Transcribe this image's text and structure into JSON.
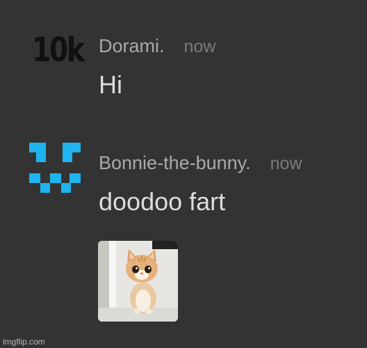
{
  "messages": [
    {
      "avatar_text": "10k",
      "author": "Dorami.",
      "time": "now",
      "content": "Hi"
    },
    {
      "avatar_icon": "pixel-face-icon",
      "author": "Bonnie-the-bunny.",
      "time": "now",
      "content": "doodoo fart",
      "attachment_icon": "kitten-photo"
    }
  ],
  "colors": {
    "background": "#333333",
    "author": "#aaaaaa",
    "time": "#7c7c7c",
    "content": "#dddddd",
    "pixel_avatar": "#1eb4f0"
  },
  "watermark": "imgflip.com"
}
